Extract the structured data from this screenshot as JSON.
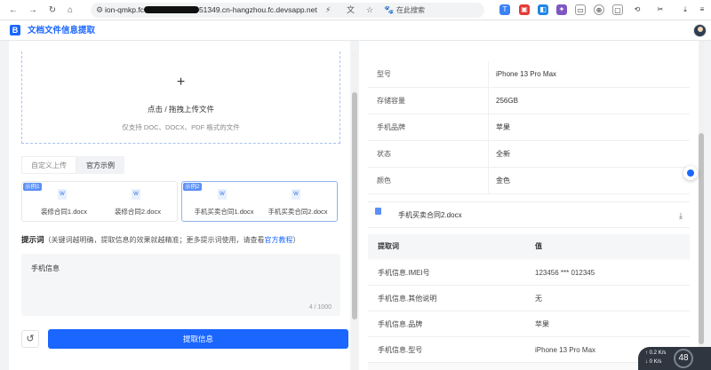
{
  "browser": {
    "url_prefix": "ion-qmkp.fc",
    "url_suffix": "51349.cn-hangzhou.fc.devsapp.net",
    "search_hint": "在此搜索"
  },
  "app": {
    "logo": "B",
    "title": "文档文件信息提取"
  },
  "upload": {
    "plus": "+",
    "title": "点击 / 拖拽上传文件",
    "hint": "仅支持 DOC、DOCX、PDF 格式的文件"
  },
  "tabs": [
    {
      "label": "自定义上传"
    },
    {
      "label": "官方示例"
    }
  ],
  "samples": [
    {
      "tag": "示例1",
      "files": [
        "装修合同1.docx",
        "装修合同2.docx"
      ]
    },
    {
      "tag": "示例2",
      "files": [
        "手机买卖合同1.docx",
        "手机买卖合同2.docx"
      ]
    }
  ],
  "prompt": {
    "label": "提示词",
    "hint": "（关键词越明确，提取信息的效果就越精准；更多提示词使用，请查看",
    "link": "官方教程",
    "hint_end": "）",
    "value": "手机信息",
    "counter": "4 / 1000"
  },
  "extract_button": "提取信息",
  "specs": [
    {
      "key": "型号",
      "value": "iPhone 13 Pro Max"
    },
    {
      "key": "存储容量",
      "value": "256GB"
    },
    {
      "key": "手机品牌",
      "value": "苹果"
    },
    {
      "key": "状态",
      "value": "全新"
    },
    {
      "key": "颜色",
      "value": "金色"
    }
  ],
  "file": {
    "name": "手机买卖合同2.docx"
  },
  "table": {
    "headers": [
      "提取词",
      "值"
    ],
    "rows": [
      {
        "k": "手机信息.IMEI号",
        "v": "123456 *** 012345"
      },
      {
        "k": "手机信息.其他说明",
        "v": "无"
      },
      {
        "k": "手机信息.品牌",
        "v": "苹果"
      },
      {
        "k": "手机信息.型号",
        "v": "iPhone 13 Pro Max"
      }
    ]
  },
  "network": {
    "up": "0.2",
    "up_unit": "K/s",
    "down": "0",
    "down_unit": "K/s",
    "percent": "48"
  }
}
